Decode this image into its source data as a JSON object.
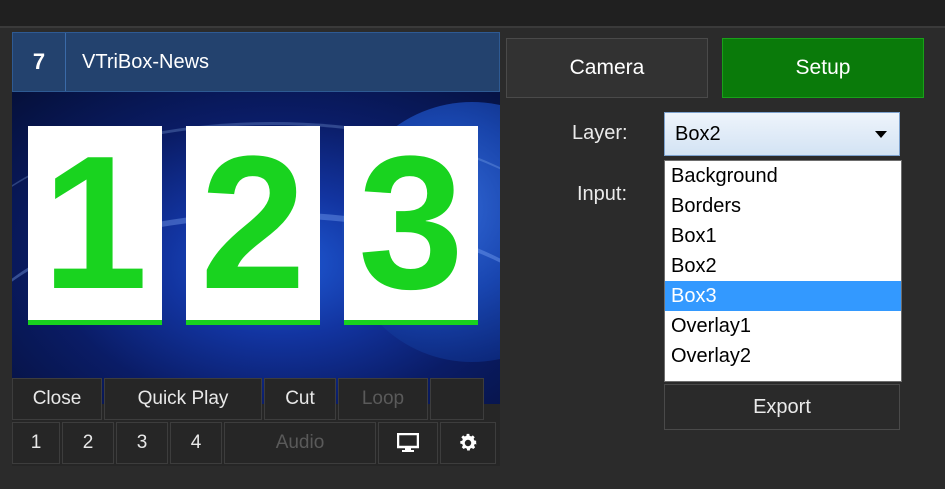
{
  "input": {
    "number": "7",
    "title": "VTriBox-News",
    "preview_digits": [
      "1",
      "2",
      "3"
    ]
  },
  "buttons_row1": [
    {
      "label": "Close",
      "enabled": true
    },
    {
      "label": "Quick Play",
      "enabled": true
    },
    {
      "label": "Cut",
      "enabled": true
    },
    {
      "label": "Loop",
      "enabled": false
    },
    {
      "label": "",
      "enabled": true
    }
  ],
  "buttons_row2": {
    "numbers": [
      "1",
      "2",
      "3",
      "4"
    ],
    "audio": "Audio",
    "monitor_icon": "monitor-icon",
    "settings_icon": "gear-icon"
  },
  "tabs": {
    "camera": "Camera",
    "setup": "Setup"
  },
  "setup": {
    "layer_label": "Layer:",
    "layer_value": "Box2",
    "input_label": "Input:",
    "layer_options": [
      "Background",
      "Borders",
      "Box1",
      "Box2",
      "Box3",
      "Overlay1",
      "Overlay2"
    ],
    "highlighted_option": "Box3",
    "export_label": "Export"
  },
  "colors": {
    "setup_active": "#0a7a0a",
    "title_bar": "#23426e",
    "digit_green": "#19d31f",
    "selection_blue": "#3399ff"
  }
}
